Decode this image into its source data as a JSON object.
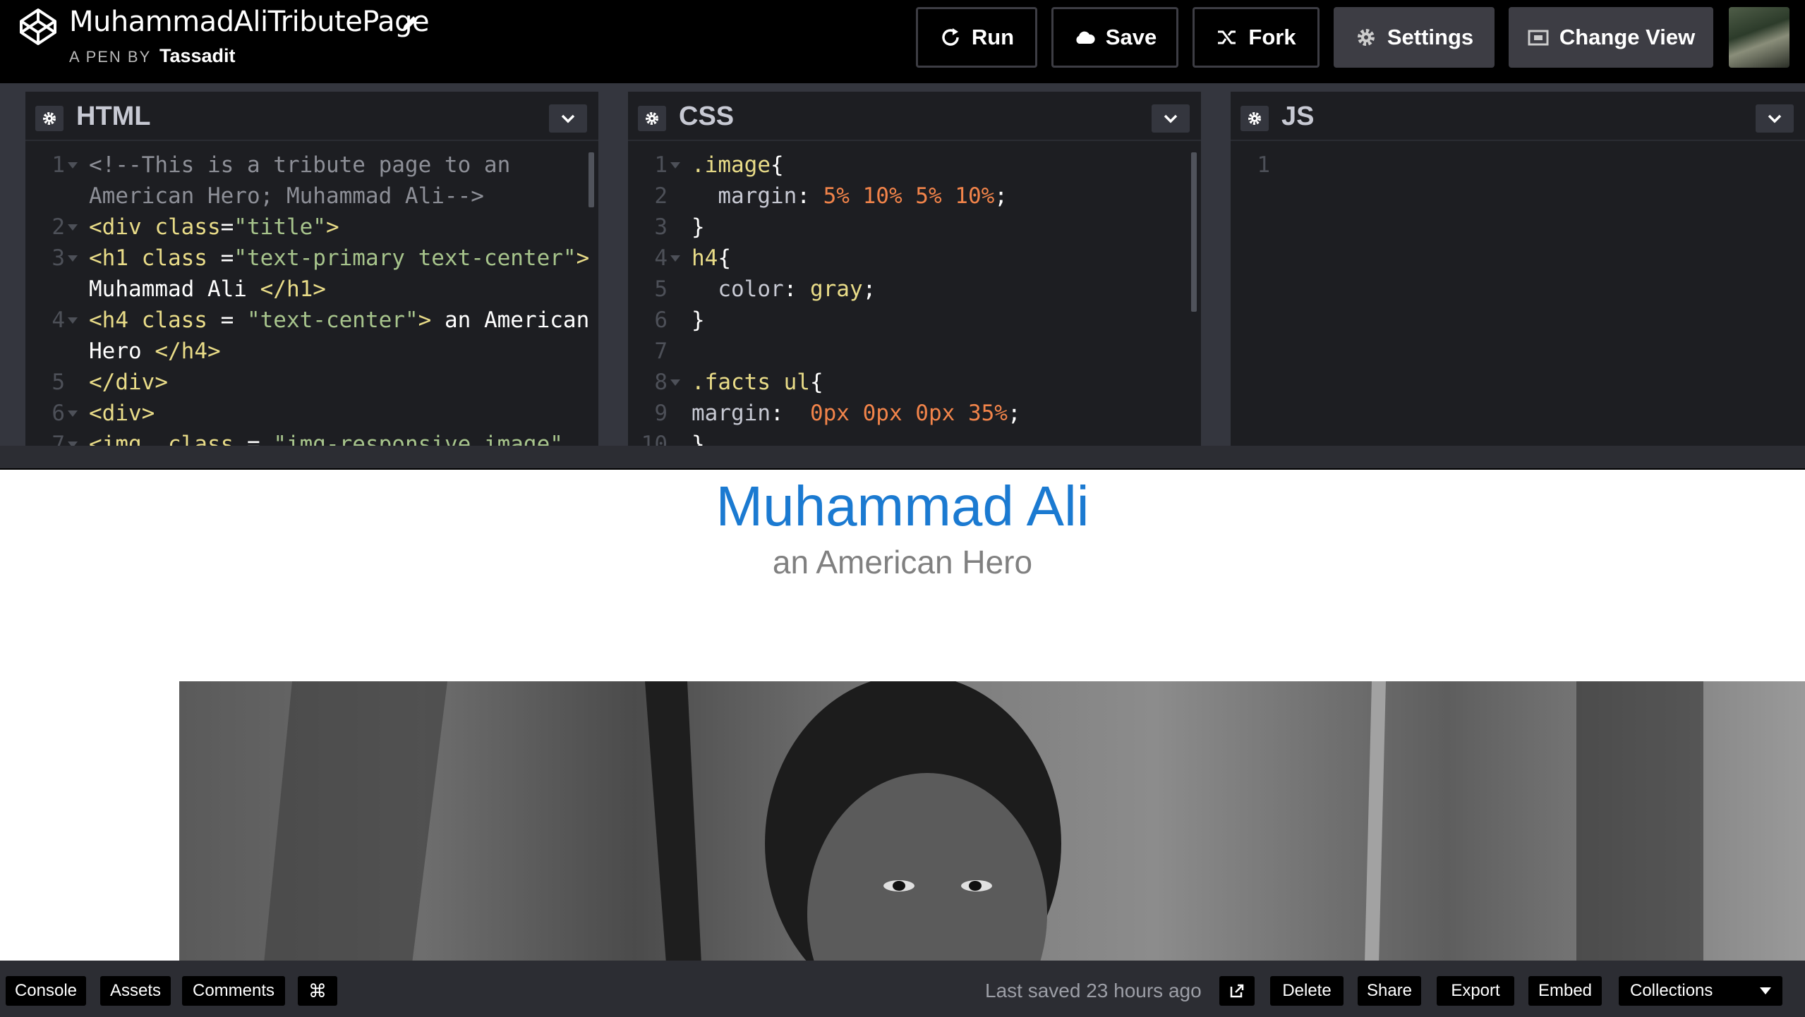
{
  "header": {
    "pen_title": "MuhammadAliTributePage",
    "byline_prefix": "A PEN BY",
    "author": "Tassadit",
    "buttons": {
      "run": "Run",
      "save": "Save",
      "fork": "Fork",
      "settings": "Settings",
      "change_view": "Change View"
    }
  },
  "editors": {
    "html": {
      "title": "HTML",
      "lines": [
        {
          "n": "1",
          "fold": true,
          "parts": [
            [
              "c-cmt",
              "<!--This is a tribute page to an"
            ]
          ]
        },
        {
          "n": "",
          "fold": false,
          "parts": [
            [
              "c-cmt",
              "American Hero; Muhammad Ali-->"
            ]
          ]
        },
        {
          "n": "2",
          "fold": true,
          "parts": [
            [
              "c-tag",
              "<div "
            ],
            [
              "c-attr",
              "class"
            ],
            [
              "c-txt",
              "="
            ],
            [
              "c-str",
              "\"title\""
            ],
            [
              "c-tag",
              ">"
            ]
          ]
        },
        {
          "n": "3",
          "fold": true,
          "parts": [
            [
              "c-tag",
              "<h1 "
            ],
            [
              "c-attr",
              "class"
            ],
            [
              "c-txt",
              " ="
            ],
            [
              "c-str",
              "\"text-primary text-center\""
            ],
            [
              "c-tag",
              ">"
            ]
          ]
        },
        {
          "n": "",
          "fold": false,
          "parts": [
            [
              "c-txt",
              "Muhammad Ali "
            ],
            [
              "c-tag",
              "</h1>"
            ]
          ]
        },
        {
          "n": "4",
          "fold": true,
          "parts": [
            [
              "c-tag",
              "<h4 "
            ],
            [
              "c-attr",
              "class"
            ],
            [
              "c-txt",
              " = "
            ],
            [
              "c-str",
              "\"text-center\""
            ],
            [
              "c-tag",
              ">"
            ],
            [
              "c-txt",
              " an American"
            ]
          ]
        },
        {
          "n": "",
          "fold": false,
          "parts": [
            [
              "c-txt",
              "Hero "
            ],
            [
              "c-tag",
              "</h4>"
            ]
          ]
        },
        {
          "n": "5",
          "fold": false,
          "parts": [
            [
              "c-tag",
              "</div>"
            ]
          ]
        },
        {
          "n": "6",
          "fold": true,
          "parts": [
            [
              "c-tag",
              "<div>"
            ]
          ]
        },
        {
          "n": "7",
          "fold": true,
          "parts": [
            [
              "c-tag",
              "<img  "
            ],
            [
              "c-attr",
              "class"
            ],
            [
              "c-txt",
              " = "
            ],
            [
              "c-str",
              "\"img-responsive image\""
            ]
          ]
        }
      ]
    },
    "css": {
      "title": "CSS",
      "lines": [
        {
          "n": "1",
          "fold": true,
          "parts": [
            [
              "c-sel",
              ".image"
            ],
            [
              "c-txt",
              "{"
            ]
          ]
        },
        {
          "n": "2",
          "fold": false,
          "parts": [
            [
              "c-prop",
              "  margin"
            ],
            [
              "c-txt",
              ": "
            ],
            [
              "c-num",
              "5% 10% 5% 10%"
            ],
            [
              "c-txt",
              ";"
            ]
          ]
        },
        {
          "n": "3",
          "fold": false,
          "parts": [
            [
              "c-txt",
              "}"
            ]
          ]
        },
        {
          "n": "4",
          "fold": true,
          "parts": [
            [
              "c-sel",
              "h4"
            ],
            [
              "c-txt",
              "{"
            ]
          ]
        },
        {
          "n": "5",
          "fold": false,
          "parts": [
            [
              "c-prop",
              "  color"
            ],
            [
              "c-txt",
              ": "
            ],
            [
              "c-kw",
              "gray"
            ],
            [
              "c-txt",
              ";"
            ]
          ]
        },
        {
          "n": "6",
          "fold": false,
          "parts": [
            [
              "c-txt",
              "}"
            ]
          ]
        },
        {
          "n": "7",
          "fold": false,
          "parts": []
        },
        {
          "n": "8",
          "fold": true,
          "parts": [
            [
              "c-sel",
              ".facts ul"
            ],
            [
              "c-txt",
              "{"
            ]
          ]
        },
        {
          "n": "9",
          "fold": false,
          "parts": [
            [
              "c-prop",
              "margin"
            ],
            [
              "c-txt",
              ":  "
            ],
            [
              "c-num",
              "0px 0px 0px 35%"
            ],
            [
              "c-txt",
              ";"
            ]
          ]
        },
        {
          "n": "10",
          "fold": false,
          "parts": [
            [
              "c-txt",
              "}"
            ]
          ]
        }
      ]
    },
    "js": {
      "title": "JS",
      "lines": [
        {
          "n": "1",
          "fold": false,
          "parts": []
        }
      ]
    }
  },
  "preview": {
    "title": "Muhammad Ali",
    "subtitle": "an American Hero"
  },
  "bottom_bar": {
    "console": "Console",
    "assets": "Assets",
    "comments": "Comments",
    "cmd_symbol": "⌘",
    "last_saved": "Last saved 23 hours ago",
    "delete": "Delete",
    "share": "Share",
    "export": "Export",
    "embed": "Embed",
    "collections": "Collections"
  },
  "colors": {
    "preview_title": "#1b7ad1",
    "preview_subtitle": "#808080",
    "code_tag": "#e9dc88",
    "code_string": "#a7c48c",
    "code_number": "#f2844a",
    "code_comment": "#8d8f97"
  }
}
